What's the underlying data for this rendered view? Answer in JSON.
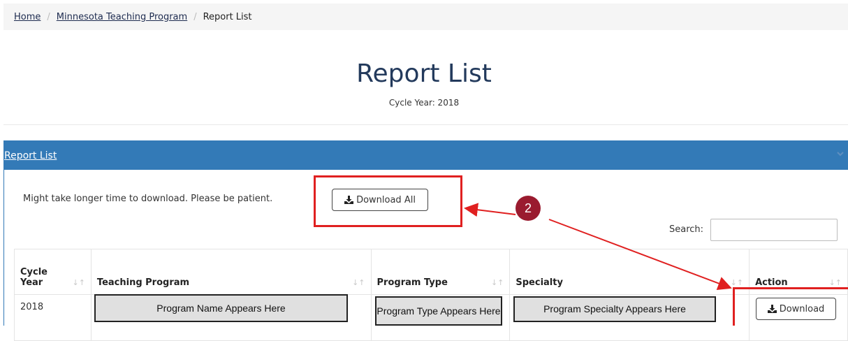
{
  "breadcrumb": {
    "home": "Home",
    "program": "Minnesota Teaching Program",
    "current": "Report List"
  },
  "page": {
    "title": "Report List",
    "cycle_year": "Cycle Year: 2018"
  },
  "panel": {
    "heading": "Report List",
    "patience_note": "Might take longer time to download. Please be patient.",
    "download_all_label": "Download All",
    "search_label": "Search:",
    "search_value": ""
  },
  "table": {
    "headers": {
      "cycle_year_line1": "Cycle",
      "cycle_year_line2": "Year",
      "teaching_program": "Teaching Program",
      "program_type": "Program Type",
      "specialty": "Specialty",
      "action": "Action"
    },
    "rows": [
      {
        "cycle_year": "2018",
        "teaching_program": "Program Name Appears Here",
        "program_type": "Program Type Appears Here",
        "specialty": "Program Specialty Appears Here",
        "action_label": "Download"
      }
    ]
  },
  "annotation": {
    "badge_number": "2",
    "color": "#e02020"
  },
  "colors": {
    "panel_header": "#337ab7",
    "title": "#233a5c"
  },
  "icons": {
    "download": "download-icon",
    "sort": "sort-icon",
    "collapse": "chevron-down-icon"
  }
}
